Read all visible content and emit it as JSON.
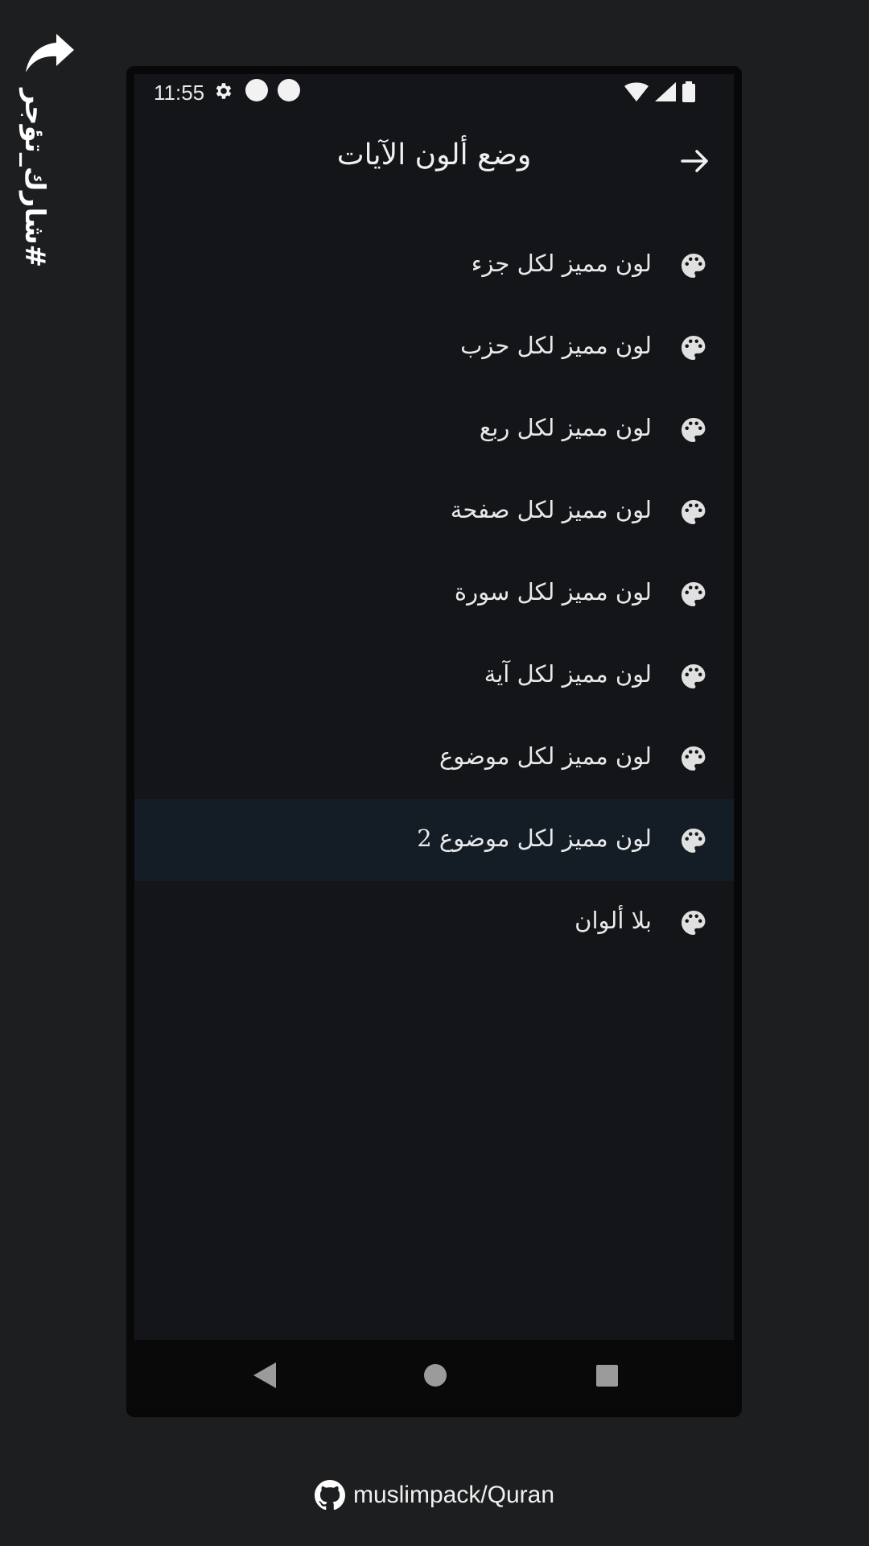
{
  "share": {
    "tag": "#شارك_تؤجر",
    "icon": "share-arrow-icon"
  },
  "status": {
    "time": "11:55"
  },
  "appbar": {
    "title": "وضع ألون الآيات",
    "back_icon": "arrow-right-icon"
  },
  "items": [
    {
      "label": "لون مميز لكل جزء",
      "icon": "palette-icon",
      "selected": false
    },
    {
      "label": "لون مميز لكل حزب",
      "icon": "palette-icon",
      "selected": false
    },
    {
      "label": "لون مميز لكل ربع",
      "icon": "palette-icon",
      "selected": false
    },
    {
      "label": "لون مميز لكل صفحة",
      "icon": "palette-icon",
      "selected": false
    },
    {
      "label": "لون مميز لكل سورة",
      "icon": "palette-icon",
      "selected": false
    },
    {
      "label": "لون مميز لكل آية",
      "icon": "palette-icon",
      "selected": false
    },
    {
      "label": "لون مميز لكل موضوع",
      "icon": "palette-icon",
      "selected": false
    },
    {
      "label": "لون مميز لكل موضوع 2",
      "icon": "palette-icon",
      "selected": true
    },
    {
      "label": "بلا ألوان",
      "icon": "palette-icon",
      "selected": false
    }
  ],
  "footer": {
    "text": "muslimpack/Quran",
    "icon": "github-icon"
  },
  "colors": {
    "background": "#1d1e20",
    "screen": "#131518",
    "selected_row": "#141c25",
    "icon": "#e0e0e0"
  }
}
